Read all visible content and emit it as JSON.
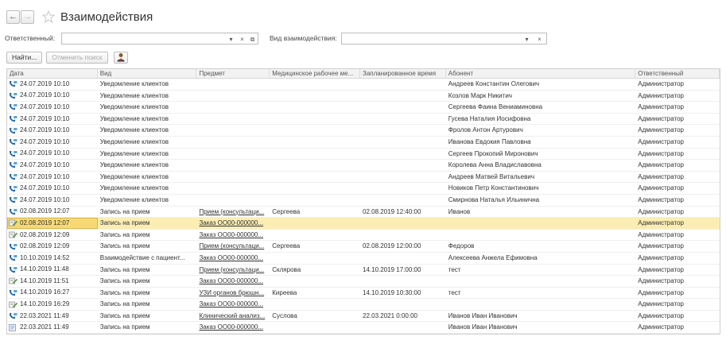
{
  "window": {
    "title": "Взаимодействия"
  },
  "filters": {
    "responsible_label": "Ответственный:",
    "responsible_value": "",
    "kind_label": "Вид взаимодействия:",
    "kind_value": ""
  },
  "toolbar": {
    "find_label": "Найти...",
    "cancel_search_label": "Отменить поиск"
  },
  "table": {
    "columns": [
      "Дата",
      "Вид",
      "Предмет",
      "Медицинское рабочее ме...",
      "Запланированное время",
      "Абонент",
      "Ответственный"
    ],
    "rows": [
      {
        "icon": "phone",
        "date": "24.07.2019 10:10",
        "kind": "Уведомление клиентов",
        "subject": "",
        "workplace": "",
        "planned": "",
        "subscriber": "Андреев Константин Олегович",
        "responsible": "Администратор"
      },
      {
        "icon": "phone",
        "date": "24.07.2019 10:10",
        "kind": "Уведомление клиентов",
        "subject": "",
        "workplace": "",
        "planned": "",
        "subscriber": "Козлов Марк Никитич",
        "responsible": "Администратор"
      },
      {
        "icon": "phone",
        "date": "24.07.2019 10:10",
        "kind": "Уведомление клиентов",
        "subject": "",
        "workplace": "",
        "planned": "",
        "subscriber": "Сергеева Фаина Вениаминовна",
        "responsible": "Администратор"
      },
      {
        "icon": "phone",
        "date": "24.07.2019 10:10",
        "kind": "Уведомление клиентов",
        "subject": "",
        "workplace": "",
        "planned": "",
        "subscriber": "Гусева Наталия Иосифовна",
        "responsible": "Администратор"
      },
      {
        "icon": "phone",
        "date": "24.07.2019 10:10",
        "kind": "Уведомление клиентов",
        "subject": "",
        "workplace": "",
        "planned": "",
        "subscriber": "Фролов Антон Артурович",
        "responsible": "Администратор"
      },
      {
        "icon": "phone",
        "date": "24.07.2019 10:10",
        "kind": "Уведомление клиентов",
        "subject": "",
        "workplace": "",
        "planned": "",
        "subscriber": "Иванова Евдокия Павловна",
        "responsible": "Администратор"
      },
      {
        "icon": "phone",
        "date": "24.07.2019 10:10",
        "kind": "Уведомление клиентов",
        "subject": "",
        "workplace": "",
        "planned": "",
        "subscriber": "Сергеев Прокопий Миронович",
        "responsible": "Администратор"
      },
      {
        "icon": "phone",
        "date": "24.07.2019 10:10",
        "kind": "Уведомление клиентов",
        "subject": "",
        "workplace": "",
        "planned": "",
        "subscriber": "Королева Анна Владиславовна",
        "responsible": "Администратор"
      },
      {
        "icon": "phone",
        "date": "24.07.2019 10:10",
        "kind": "Уведомление клиентов",
        "subject": "",
        "workplace": "",
        "planned": "",
        "subscriber": "Андреев Матвей Витальевич",
        "responsible": "Администратор"
      },
      {
        "icon": "phone",
        "date": "24.07.2019 10:10",
        "kind": "Уведомление клиентов",
        "subject": "",
        "workplace": "",
        "planned": "",
        "subscriber": "Новиков Петр Константинович",
        "responsible": "Администратор"
      },
      {
        "icon": "phone",
        "date": "24.07.2019 10:10",
        "kind": "Уведомление клиентов",
        "subject": "",
        "workplace": "",
        "planned": "",
        "subscriber": "Смирнова Наталья Ильинична",
        "responsible": "Администратор"
      },
      {
        "icon": "phone",
        "date": "02.08.2019 12:07",
        "kind": "Запись на прием",
        "subject": "Прием (консультаци...",
        "workplace": "Сергеева",
        "planned": "02.08.2019 12:40:00",
        "subscriber": "Иванов",
        "responsible": "Администратор"
      },
      {
        "icon": "note",
        "date": "02.08.2019 12:07",
        "kind": "Запись на прием",
        "subject": "Заказ ОО00-000000...",
        "workplace": "",
        "planned": "",
        "subscriber": "",
        "responsible": "Администратор",
        "selected": true
      },
      {
        "icon": "note",
        "date": "02.08.2019 12:09",
        "kind": "Запись на прием",
        "subject": "Заказ ОО00-000000...",
        "workplace": "",
        "planned": "",
        "subscriber": "",
        "responsible": "Администратор"
      },
      {
        "icon": "phone",
        "date": "02.08.2019 12:09",
        "kind": "Запись на прием",
        "subject": "Прием (консультаци...",
        "workplace": "Сергеева",
        "planned": "02.08.2019 12:00:00",
        "subscriber": "Федоров",
        "responsible": "Администратор"
      },
      {
        "icon": "phone",
        "date": "10.10.2019 14:52",
        "kind": "Взаимодействие с пациент...",
        "subject": "Заказ ОО00-000000...",
        "workplace": "",
        "planned": "",
        "subscriber": "Алексеева Анжела Ефимовна",
        "responsible": "Администратор"
      },
      {
        "icon": "phone",
        "date": "14.10.2019 11:48",
        "kind": "Запись на прием",
        "subject": "Прием (консультаци...",
        "workplace": "Склярова",
        "planned": "14.10.2019 17:00:00",
        "subscriber": "тест",
        "responsible": "Администратор"
      },
      {
        "icon": "note",
        "date": "14.10.2019 11:51",
        "kind": "Запись на прием",
        "subject": "Заказ ОО00-000000...",
        "workplace": "",
        "planned": "",
        "subscriber": "",
        "responsible": "Администратор"
      },
      {
        "icon": "phone",
        "date": "14.10.2019 16:27",
        "kind": "Запись на прием",
        "subject": "УЗИ органов брюшн...",
        "workplace": "Киреева",
        "planned": "14.10.2019 10:30:00",
        "subscriber": "тест",
        "responsible": "Администратор"
      },
      {
        "icon": "note",
        "date": "14.10.2019 16:29",
        "kind": "Запись на прием",
        "subject": "Заказ ОО00-000000...",
        "workplace": "",
        "planned": "",
        "subscriber": "",
        "responsible": "Администратор"
      },
      {
        "icon": "phone",
        "date": "22.03.2021 11:49",
        "kind": "Запись на прием",
        "subject": "Клинический анализ...",
        "workplace": "Суслова",
        "planned": "22.03.2021 0:00:00",
        "subscriber": "Иванов Иван Иванович",
        "responsible": "Администратор"
      },
      {
        "icon": "doc",
        "date": "22.03.2021 11:49",
        "kind": "Запись на прием",
        "subject": "Заказ ОО00-000000...",
        "workplace": "",
        "planned": "",
        "subscriber": "Иванов Иван Иванович",
        "responsible": "Администратор"
      }
    ]
  }
}
